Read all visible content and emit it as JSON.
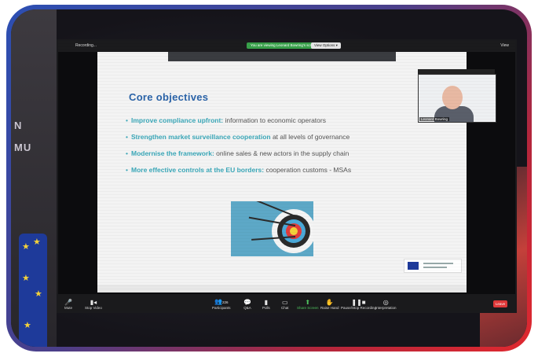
{
  "wall_text": [
    "N",
    "MU"
  ],
  "zoom": {
    "recording_label": "Recording...",
    "share_notice": "You are viewing Leonard Bowring's screen",
    "view_options_label": "View Options ▾",
    "view_label": "View",
    "participant_count": "226",
    "participant_name": "Leonard Bowring",
    "leave_label": "Leave",
    "toolbar": [
      {
        "id": "mute",
        "label": "Mute",
        "icon": "microphone-icon"
      },
      {
        "id": "stop-video",
        "label": "Stop Video",
        "icon": "video-camera-icon"
      },
      {
        "id": "participants",
        "label": "Participants",
        "icon": "people-icon"
      },
      {
        "id": "qa",
        "label": "Q&A",
        "icon": "qa-icon"
      },
      {
        "id": "polls",
        "label": "Polls",
        "icon": "polls-icon"
      },
      {
        "id": "chat",
        "label": "Chat",
        "icon": "chat-icon"
      },
      {
        "id": "share-screen",
        "label": "Share Screen",
        "icon": "share-screen-icon"
      },
      {
        "id": "raise-hand",
        "label": "Raise Hand",
        "icon": "hand-icon"
      },
      {
        "id": "pause-recording",
        "label": "Pause/Stop Recording",
        "icon": "pause-stop-icon"
      },
      {
        "id": "interpretation",
        "label": "Interpretation",
        "icon": "globe-icon"
      }
    ]
  },
  "slide": {
    "title": "Core objectives",
    "bullets": [
      {
        "highlight": "Improve compliance upfront:",
        "rest": " information to economic operators"
      },
      {
        "highlight": "Strengthen market surveillance cooperation",
        "rest": " at all levels of governance"
      },
      {
        "highlight": "Modernise the framework:",
        "rest": " online sales & new actors in the supply chain"
      },
      {
        "highlight": "More effective controls at the EU borders:",
        "rest": " cooperation customs - MSAs"
      }
    ]
  },
  "colors": {
    "frame_gradient_start": "#2c4fb3",
    "frame_gradient_end": "#e0282f",
    "slide_title": "#2a63a8",
    "bullet_highlight": "#3aa7b8",
    "zoom_green": "#4fc35f",
    "leave_red": "#e0393a"
  }
}
